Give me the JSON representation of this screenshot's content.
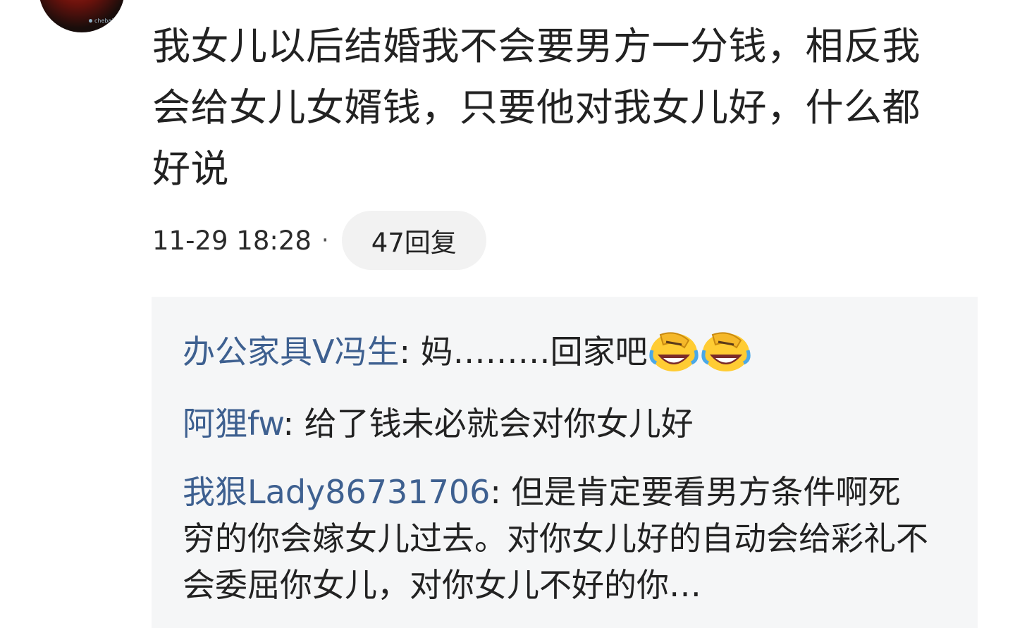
{
  "comment": {
    "avatar_watermark": "chebaiq",
    "text": "我女儿以后结婚我不会要男方一分钱，相反我会给女儿女婿钱，只要他对我女儿好，什么都好说",
    "timestamp": "11-29 18:28",
    "separator": "·",
    "reply_count_label": "47回复"
  },
  "replies": [
    {
      "user": "办公家具V冯生",
      "colon": ": ",
      "text": "妈………回家吧",
      "emojis": [
        "facepalm-laugh-emoji",
        "facepalm-laugh-emoji"
      ]
    },
    {
      "user": "阿狸fw",
      "colon": ": ",
      "text": "给了钱未必就会对你女儿好"
    },
    {
      "user": "我狠Lady86731706",
      "colon": ": ",
      "text": "但是肯定要看男方条件啊死穷的你会嫁女儿过去。对你女儿好的自动会给彩礼不会委屈你女儿，对你女儿不好的你…"
    }
  ],
  "colors": {
    "username": "#3e6090",
    "panel_bg": "#f5f6f7",
    "pill_bg": "#f2f2f2"
  }
}
